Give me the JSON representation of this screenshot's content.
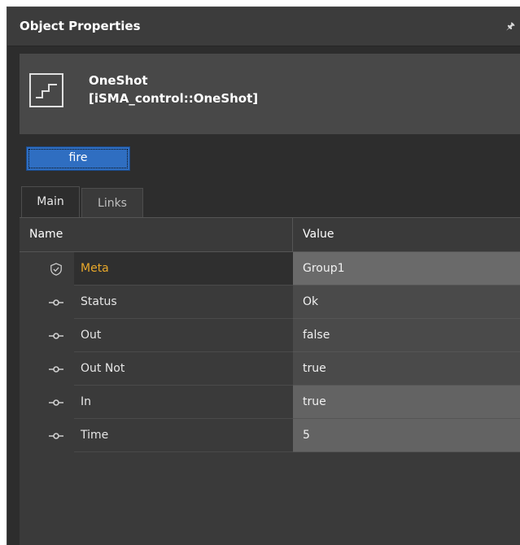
{
  "panel": {
    "title": "Object Properties",
    "pin_icon": "pin-icon"
  },
  "object": {
    "name": "OneShot",
    "type": "[iSMA_control::OneShot]",
    "icon": "oneshot-pulse-icon"
  },
  "actions": {
    "fire_label": "fire"
  },
  "tabs": [
    {
      "label": "Main",
      "active": true
    },
    {
      "label": "Links",
      "active": false
    }
  ],
  "grid": {
    "columns": {
      "name": "Name",
      "value": "Value"
    },
    "rows": [
      {
        "name": "Meta",
        "value": "Group1",
        "icon": "shield-check-icon"
      },
      {
        "name": "Status",
        "value": "Ok",
        "icon": "slot-icon"
      },
      {
        "name": "Out",
        "value": "false",
        "icon": "slot-icon"
      },
      {
        "name": "Out Not",
        "value": "true",
        "icon": "slot-icon"
      },
      {
        "name": "In",
        "value": "true",
        "icon": "slot-icon"
      },
      {
        "name": "Time",
        "value": "5",
        "icon": "slot-icon"
      }
    ]
  },
  "colors": {
    "background": "#2d2d2d",
    "meta_label": "#e8a82a",
    "button": "#2f6ec1"
  }
}
